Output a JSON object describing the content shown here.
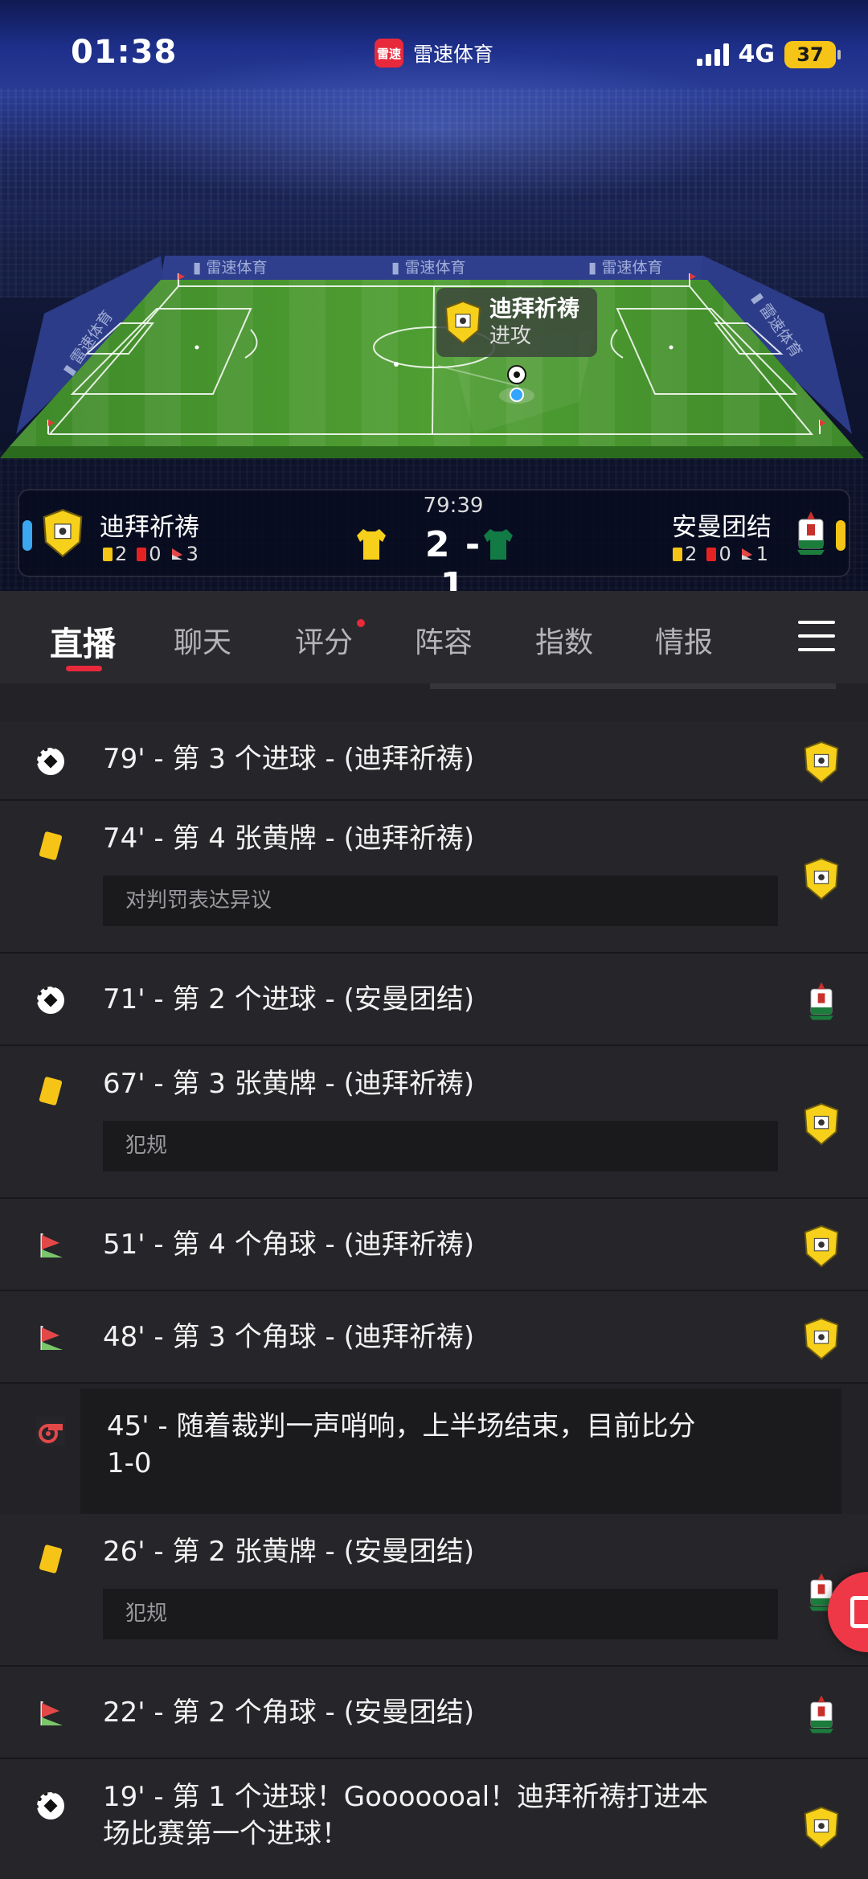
{
  "status_bar": {
    "time": "01:38",
    "app": "雷速体育",
    "app_icon_text": "雷速",
    "network": "4G",
    "battery": "37"
  },
  "pitch": {
    "banner": [
      "雷速体育",
      "雷速体育",
      "雷速体育",
      "雷速体育",
      "雷速体育"
    ],
    "popup": {
      "team": "迪拜祈祷",
      "action": "进攻"
    }
  },
  "match": {
    "minute": "79:39",
    "home": {
      "name": "迪拜祈祷",
      "yellow": "2",
      "red": "0",
      "corners": "3",
      "color": "#f6d01a"
    },
    "away": {
      "name": "安曼团结",
      "yellow": "2",
      "red": "0",
      "corners": "1",
      "color": "#117a45"
    },
    "score": "2 - 1"
  },
  "tabs": [
    {
      "label": "直播",
      "active": true
    },
    {
      "label": "聊天",
      "active": false
    },
    {
      "label": "评分",
      "active": false,
      "dot": true
    },
    {
      "label": "阵容",
      "active": false
    },
    {
      "label": "指数",
      "active": false
    },
    {
      "label": "情报",
      "active": false
    }
  ],
  "events": [
    {
      "icon": "goal",
      "text": "79' - 第 3 个进球 - (迪拜祈祷)",
      "note": "",
      "team": "home"
    },
    {
      "icon": "yellow-card",
      "text": "74' - 第 4 张黄牌 - (迪拜祈祷)",
      "note": "对判罚表达异议",
      "team": "home"
    },
    {
      "icon": "goal",
      "text": "71' - 第 2 个进球 - (安曼团结)",
      "note": "",
      "team": "away"
    },
    {
      "icon": "yellow-card",
      "text": "67' - 第 3 张黄牌 - (迪拜祈祷)",
      "note": "犯规",
      "team": "home"
    },
    {
      "icon": "corner",
      "text": "51' - 第 4 个角球 - (迪拜祈祷)",
      "note": "",
      "team": "home"
    },
    {
      "icon": "corner",
      "text": "48' - 第 3 个角球 - (迪拜祈祷)",
      "note": "",
      "team": "home"
    },
    {
      "icon": "whistle",
      "text": "45' - 随着裁判一声哨响，上半场结束，目前比分",
      "text2": "1-0",
      "note": "",
      "team": ""
    },
    {
      "icon": "yellow-card",
      "text": "26' - 第 2 张黄牌 - (安曼团结)",
      "note": "犯规",
      "team": "away"
    },
    {
      "icon": "corner",
      "text": "22' - 第 2 个角球 - (安曼团结)",
      "note": "",
      "team": "away"
    },
    {
      "icon": "goal",
      "text": "19' - 第 1 个进球！Gooooooal！迪拜祈祷打进本",
      "text2": "场比赛第一个进球！",
      "note": "",
      "team": "home"
    }
  ]
}
